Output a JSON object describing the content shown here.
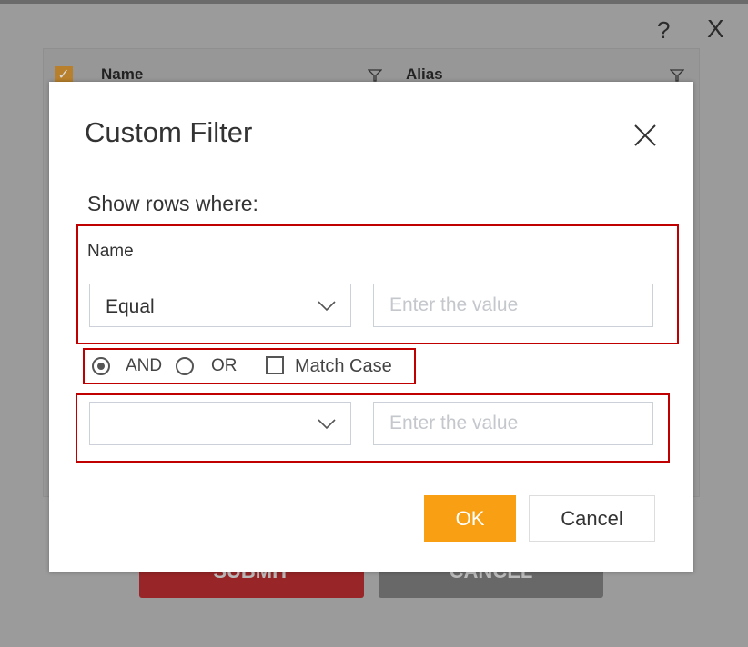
{
  "background": {
    "help_icon": "?",
    "close_icon": "X",
    "columns": [
      "Name",
      "Alias"
    ],
    "submit_label": "SUBMIT",
    "cancel_label": "CANCEL"
  },
  "dialog": {
    "title": "Custom Filter",
    "prompt": "Show rows where:",
    "field_label": "Name",
    "first": {
      "operator": "Equal",
      "value": "",
      "placeholder": "Enter the value"
    },
    "logic": {
      "and_label": "AND",
      "or_label": "OR",
      "selected": "AND",
      "match_case_label": "Match Case",
      "match_case": false
    },
    "second": {
      "operator": "",
      "value": "",
      "placeholder": "Enter the value"
    },
    "ok_label": "OK",
    "cancel_label": "Cancel"
  },
  "colors": {
    "accent": "#f99f14",
    "highlight": "#c00000",
    "submit": "#982527"
  }
}
